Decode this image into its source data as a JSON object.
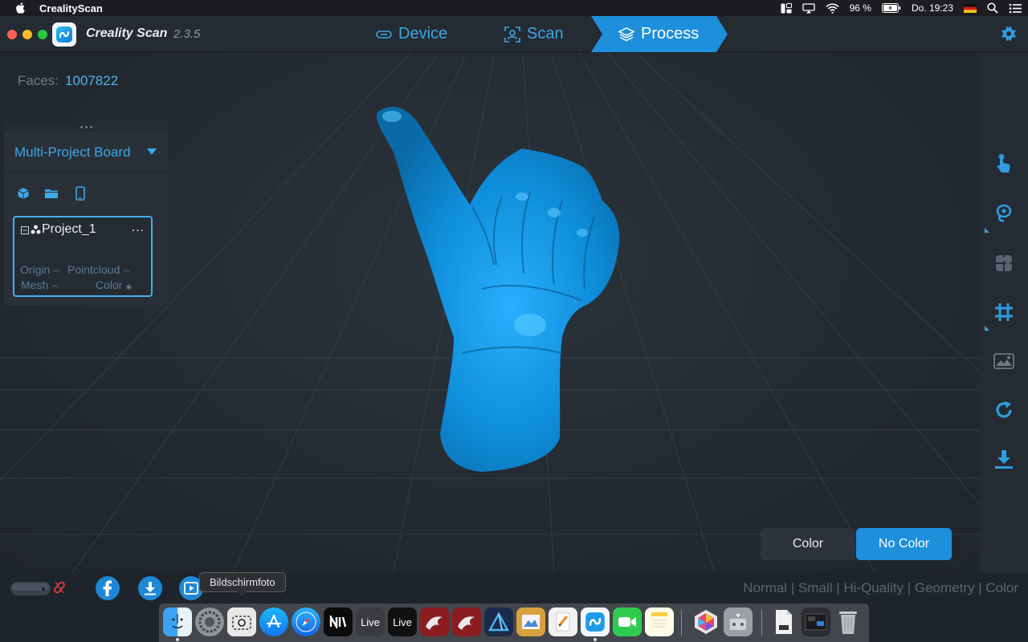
{
  "menubar": {
    "app_name": "CrealityScan",
    "battery": "96 %",
    "clock": "Do. 19:23"
  },
  "app": {
    "title": "Creality Scan",
    "version": "2.3.5"
  },
  "nav": {
    "tabs": [
      {
        "label": "Device",
        "icon": "device-icon"
      },
      {
        "label": "Scan",
        "icon": "scan-icon"
      },
      {
        "label": "Process",
        "icon": "layers-icon",
        "active": true
      }
    ]
  },
  "viewport": {
    "faces_label": "Faces:",
    "faces_value": "1007822",
    "model_color": "#0f8fd6"
  },
  "board": {
    "title": "Multi-Project Board",
    "icons": [
      "cube-icon",
      "folder-icon",
      "phone-icon"
    ],
    "project": {
      "name": "Project_1",
      "more": "...",
      "layers": {
        "origin": "Origin",
        "pointcloud": "Pointcloud",
        "mesh": "Mesh",
        "color": "Color"
      }
    }
  },
  "right_toolbar": {
    "tools": [
      "hand-pointer-icon",
      "lasso-icon",
      "puzzle-icon",
      "grid-crop-icon",
      "image-icon",
      "rotate-icon",
      "download-icon"
    ]
  },
  "color_toggle": {
    "color_label": "Color",
    "nocolor_label": "No Color",
    "active": "No Color"
  },
  "bottom": {
    "share_icons": [
      "facebook-icon",
      "download-icon",
      "play-icon"
    ],
    "modes": [
      "Normal",
      "Small",
      "Hi-Quality",
      "Geometry",
      "Color"
    ],
    "separator": " | "
  },
  "tooltip": "Bildschirmfoto",
  "dock": {
    "items": [
      "Finder",
      "System Preferences",
      "Screenshot",
      "App Store",
      "Safari",
      "Notion",
      "Live",
      "Live",
      "Creality Print",
      "Creality Slicer",
      "Affinity",
      "Preview",
      "Pages",
      "Creality Scan",
      "FaceTime",
      "Notes",
      "Color",
      "Migration",
      "File",
      "Screens",
      "Trash"
    ],
    "live_label": "Live"
  },
  "colors": {
    "accent": "#1e8fda",
    "link": "#39a8e6",
    "background": "#1e242b"
  }
}
